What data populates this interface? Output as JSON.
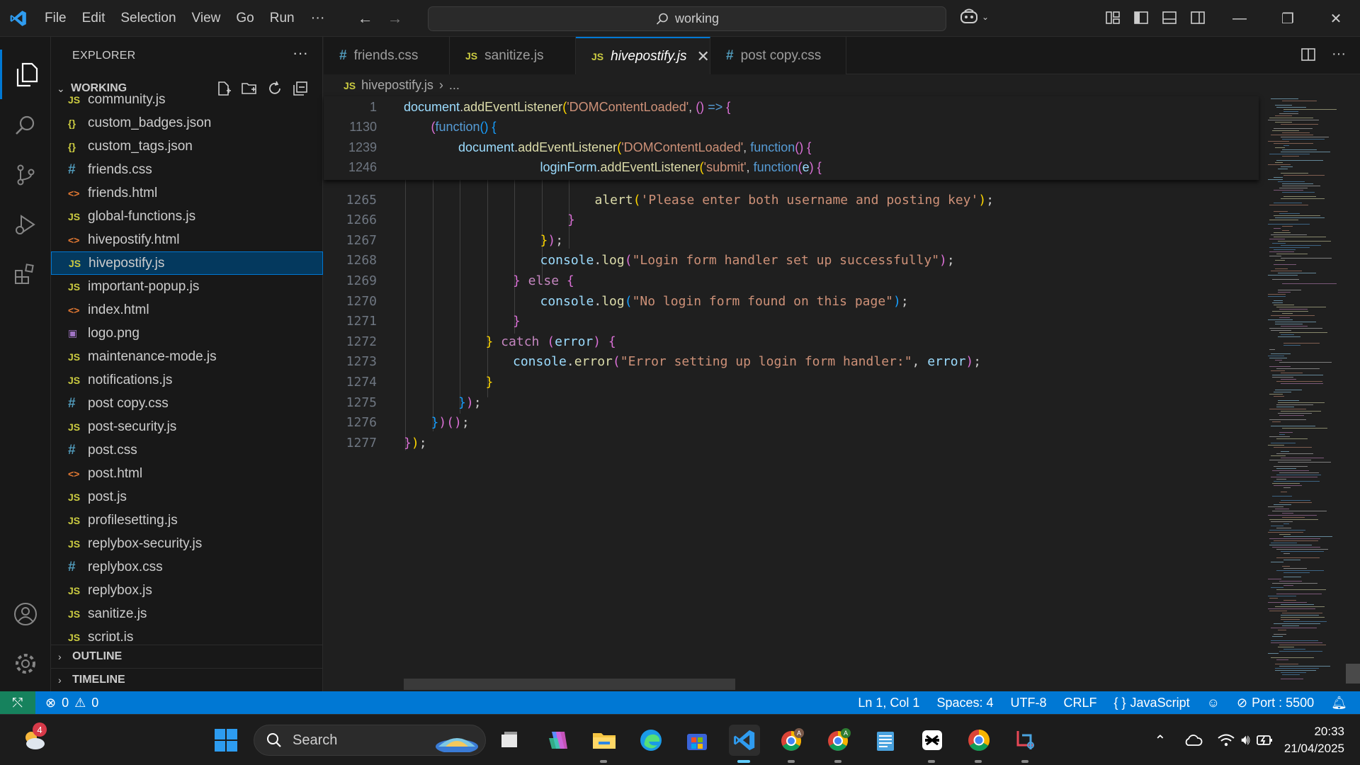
{
  "titlebar": {
    "menu": [
      "File",
      "Edit",
      "Selection",
      "View",
      "Go",
      "Run"
    ],
    "more": "···",
    "search_text": "working"
  },
  "explorer": {
    "title": "EXPLORER",
    "more": "···",
    "section": "WORKING",
    "files": [
      {
        "name": "community.js",
        "type": "js"
      },
      {
        "name": "custom_badges.json",
        "type": "json"
      },
      {
        "name": "custom_tags.json",
        "type": "json"
      },
      {
        "name": "friends.css",
        "type": "css"
      },
      {
        "name": "friends.html",
        "type": "html"
      },
      {
        "name": "global-functions.js",
        "type": "js"
      },
      {
        "name": "hivepostify.html",
        "type": "html"
      },
      {
        "name": "hivepostify.js",
        "type": "js",
        "selected": true
      },
      {
        "name": "important-popup.js",
        "type": "js"
      },
      {
        "name": "index.html",
        "type": "html"
      },
      {
        "name": "logo.png",
        "type": "png"
      },
      {
        "name": "maintenance-mode.js",
        "type": "js"
      },
      {
        "name": "notifications.js",
        "type": "js"
      },
      {
        "name": "post copy.css",
        "type": "css"
      },
      {
        "name": "post-security.js",
        "type": "js"
      },
      {
        "name": "post.css",
        "type": "css"
      },
      {
        "name": "post.html",
        "type": "html"
      },
      {
        "name": "post.js",
        "type": "js"
      },
      {
        "name": "profilesetting.js",
        "type": "js"
      },
      {
        "name": "replybox-security.js",
        "type": "js"
      },
      {
        "name": "replybox.css",
        "type": "css"
      },
      {
        "name": "replybox.js",
        "type": "js"
      },
      {
        "name": "sanitize.js",
        "type": "js"
      },
      {
        "name": "script.js",
        "type": "js"
      }
    ],
    "outline": "OUTLINE",
    "timeline": "TIMELINE"
  },
  "tabs": [
    {
      "name": "friends.css",
      "type": "css"
    },
    {
      "name": "sanitize.js",
      "type": "js"
    },
    {
      "name": "hivepostify.js",
      "type": "js",
      "active": true
    },
    {
      "name": "post copy.css",
      "type": "css"
    }
  ],
  "breadcrumb": {
    "file": "hivepostify.js",
    "rest": "..."
  },
  "sticky_lines": [
    {
      "num": "1",
      "indent": 0,
      "tokens": [
        [
          "var",
          "document"
        ],
        [
          "",
          "."
        ],
        [
          "fn",
          "addEventListener"
        ],
        [
          "p1",
          "("
        ],
        [
          "str",
          "'DOMContentLoaded'"
        ],
        [
          "",
          ", "
        ],
        [
          "p2",
          "()"
        ],
        [
          "kw",
          " =>"
        ],
        [
          "",
          ""
        ],
        [
          "p2",
          " {"
        ]
      ]
    },
    {
      "num": "1130",
      "indent": 1,
      "tokens": [
        [
          "p2",
          "("
        ],
        [
          "kw",
          "function"
        ],
        [
          "p3",
          "()"
        ],
        [
          "p3",
          " {"
        ]
      ]
    },
    {
      "num": "1239",
      "indent": 2,
      "tokens": [
        [
          "var",
          "document"
        ],
        [
          "",
          "."
        ],
        [
          "fn",
          "addEventListener"
        ],
        [
          "p1",
          "("
        ],
        [
          "str",
          "'DOMContentLoaded'"
        ],
        [
          "",
          ", "
        ],
        [
          "kw",
          "function"
        ],
        [
          "p2",
          "()"
        ],
        [
          "p2",
          " {"
        ]
      ]
    },
    {
      "num": "1246",
      "indent": 5,
      "tokens": [
        [
          "var",
          "loginForm"
        ],
        [
          "",
          "."
        ],
        [
          "fn",
          "addEventListener"
        ],
        [
          "p1",
          "("
        ],
        [
          "str",
          "'submit'"
        ],
        [
          "",
          ", "
        ],
        [
          "kw",
          "function"
        ],
        [
          "p2",
          "("
        ],
        [
          "var",
          "e"
        ],
        [
          "p2",
          ")"
        ],
        [
          "p2",
          " {"
        ]
      ]
    }
  ],
  "code_lines": [
    {
      "num": "1265",
      "indent": 7,
      "tokens": [
        [
          "fn",
          "alert"
        ],
        [
          "p1",
          "("
        ],
        [
          "str",
          "'Please enter both username and posting key'"
        ],
        [
          "p1",
          ")"
        ],
        [
          "",
          ";"
        ]
      ]
    },
    {
      "num": "1266",
      "indent": 6,
      "tokens": [
        [
          "p2",
          "}"
        ]
      ]
    },
    {
      "num": "1267",
      "indent": 5,
      "tokens": [
        [
          "p1",
          "}"
        ],
        [
          "p2",
          ")"
        ],
        [
          "",
          ";"
        ]
      ]
    },
    {
      "num": "1268",
      "indent": 5,
      "tokens": [
        [
          "var",
          "console"
        ],
        [
          "",
          "."
        ],
        [
          "fn",
          "log"
        ],
        [
          "p2",
          "("
        ],
        [
          "str",
          "\"Login form handler set up successfully\""
        ],
        [
          "p2",
          ")"
        ],
        [
          "",
          ";"
        ]
      ]
    },
    {
      "num": "1269",
      "indent": 4,
      "tokens": [
        [
          "p2",
          "}"
        ],
        [
          "ctrl",
          " else"
        ],
        [
          "p2",
          " {"
        ]
      ]
    },
    {
      "num": "1270",
      "indent": 5,
      "tokens": [
        [
          "var",
          "console"
        ],
        [
          "",
          "."
        ],
        [
          "fn",
          "log"
        ],
        [
          "p3",
          "("
        ],
        [
          "str",
          "\"No login form found on this page\""
        ],
        [
          "p3",
          ")"
        ],
        [
          "",
          ";"
        ]
      ]
    },
    {
      "num": "1271",
      "indent": 4,
      "tokens": [
        [
          "p2",
          "}"
        ]
      ]
    },
    {
      "num": "1272",
      "indent": 3,
      "tokens": [
        [
          "p1",
          "}"
        ],
        [
          "ctrl",
          " catch"
        ],
        [
          "",
          ""
        ],
        [
          "p2",
          " ("
        ],
        [
          "var",
          "error"
        ],
        [
          "p2",
          ")"
        ],
        [
          "p2",
          " {"
        ]
      ]
    },
    {
      "num": "1273",
      "indent": 4,
      "tokens": [
        [
          "var",
          "console"
        ],
        [
          "",
          "."
        ],
        [
          "fn",
          "error"
        ],
        [
          "p2",
          "("
        ],
        [
          "str",
          "\"Error setting up login form handler:\""
        ],
        [
          "",
          ", "
        ],
        [
          "var",
          "error"
        ],
        [
          "p2",
          ")"
        ],
        [
          "",
          ";"
        ]
      ]
    },
    {
      "num": "1274",
      "indent": 3,
      "tokens": [
        [
          "p1",
          "}"
        ]
      ]
    },
    {
      "num": "1275",
      "indent": 2,
      "tokens": [
        [
          "p3",
          "}"
        ],
        [
          "p2",
          ")"
        ],
        [
          "",
          ";"
        ]
      ]
    },
    {
      "num": "1276",
      "indent": 1,
      "tokens": [
        [
          "p3",
          "}"
        ],
        [
          "p2",
          ")"
        ],
        [
          "p2",
          "()"
        ],
        [
          "",
          ";"
        ]
      ]
    },
    {
      "num": "1277",
      "indent": 0,
      "tokens": [
        [
          "p2",
          "}"
        ],
        [
          "p1",
          ")"
        ],
        [
          "",
          ";"
        ]
      ]
    }
  ],
  "statusbar": {
    "errors": "0",
    "warnings": "0",
    "position": "Ln 1, Col 1",
    "spaces": "Spaces: 4",
    "encoding": "UTF-8",
    "eol": "CRLF",
    "language": "JavaScript",
    "port": "Port : 5500"
  },
  "taskbar": {
    "search_placeholder": "Search",
    "weather_badge": "4",
    "time": "20:33",
    "date": "21/04/2025"
  },
  "colors": {
    "accent": "#0078d4",
    "statusbar": "#0078d4",
    "remote": "#16825d"
  }
}
